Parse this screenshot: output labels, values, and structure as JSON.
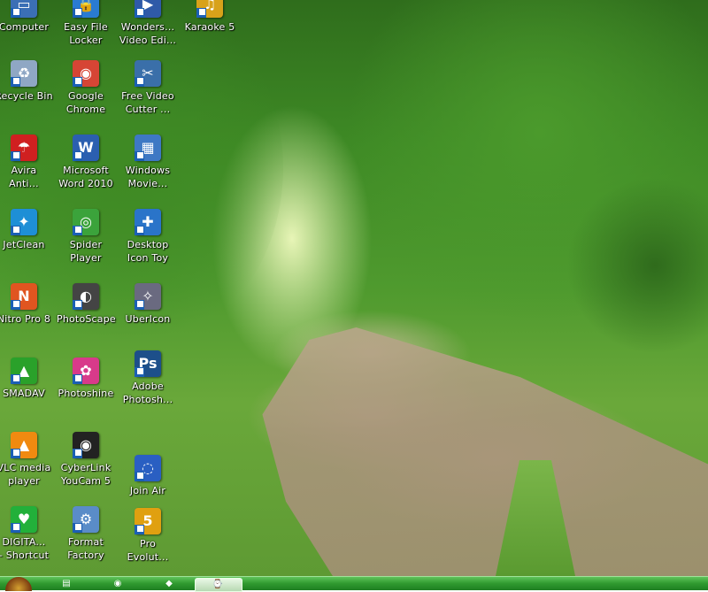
{
  "desktop": {
    "icons": [
      {
        "label": "Computer",
        "glyph": "▭",
        "color": "#3b6fb5"
      },
      {
        "label": "Easy File\nLocker",
        "glyph": "🔒",
        "color": "#2a7bd1"
      },
      {
        "label": "Wonders...\nVideo Edi...",
        "glyph": "▶",
        "color": "#2f5aa8"
      },
      {
        "label": "Karaoke 5",
        "glyph": "♫",
        "color": "#d8a21a"
      },
      {
        "label": "Recycle Bin",
        "glyph": "♻",
        "color": "#8fa7c4"
      },
      {
        "label": "Google\nChrome",
        "glyph": "◉",
        "color": "#d64535"
      },
      {
        "label": "Free Video\nCutter ...",
        "glyph": "✂",
        "color": "#3a6fa9"
      },
      {
        "label": "Avira\nAnti...",
        "glyph": "☂",
        "color": "#d02020"
      },
      {
        "label": "Microsoft\nWord 2010",
        "glyph": "W",
        "color": "#2b5fb0"
      },
      {
        "label": "Windows\nMovie...",
        "glyph": "▦",
        "color": "#3e78c4"
      },
      {
        "label": "JetClean",
        "glyph": "✦",
        "color": "#1e8fd6"
      },
      {
        "label": "Spider\nPlayer",
        "glyph": "◎",
        "color": "#3ba33b"
      },
      {
        "label": "Desktop\nIcon Toy",
        "glyph": "✚",
        "color": "#2a74c9"
      },
      {
        "label": "Nitro Pro 8",
        "glyph": "N",
        "color": "#e05520"
      },
      {
        "label": "PhotoScape",
        "glyph": "◐",
        "color": "#444444"
      },
      {
        "label": "UberIcon",
        "glyph": "✧",
        "color": "#6a6a80"
      },
      {
        "label": "SMADAV",
        "glyph": "▲",
        "color": "#2aa12a"
      },
      {
        "label": "Photoshine",
        "glyph": "✿",
        "color": "#d83a8a"
      },
      {
        "label": "Adobe\nPhotosh...",
        "glyph": "Ps",
        "color": "#1d4f8a"
      },
      {
        "label": "VLC media\nplayer",
        "glyph": "▲",
        "color": "#f08a10"
      },
      {
        "label": "CyberLink\nYouCam 5",
        "glyph": "◉",
        "color": "#222222"
      },
      {
        "label": "Join Air",
        "glyph": "◌",
        "color": "#2a5fc2"
      },
      {
        "label": "DIGITA...\n- Shortcut",
        "glyph": "♥",
        "color": "#22b03a"
      },
      {
        "label": "Format\nFactory",
        "glyph": "⚙",
        "color": "#5a8cc8"
      },
      {
        "label": "Pro\nEvolut...",
        "glyph": "5",
        "color": "#e0a010"
      }
    ]
  },
  "taskbar": {
    "items": [
      {
        "name": "start",
        "glyph": ""
      },
      {
        "name": "explorer",
        "glyph": "▤"
      },
      {
        "name": "chrome",
        "glyph": "◉"
      },
      {
        "name": "media",
        "glyph": "◆"
      },
      {
        "name": "active-app",
        "glyph": "⌚"
      }
    ]
  }
}
